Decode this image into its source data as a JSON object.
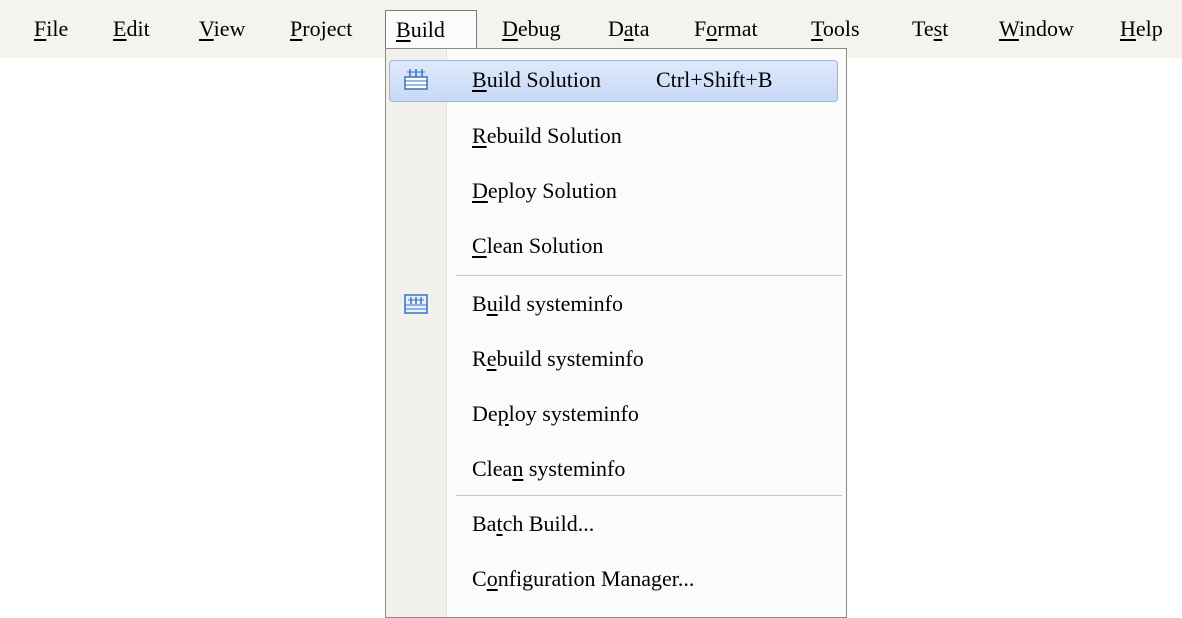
{
  "menubar": {
    "items": [
      {
        "pre": "",
        "u": "F",
        "post": "ile"
      },
      {
        "pre": "",
        "u": "E",
        "post": "dit"
      },
      {
        "pre": "",
        "u": "V",
        "post": "iew"
      },
      {
        "pre": "",
        "u": "P",
        "post": "roject"
      },
      {
        "pre": "",
        "u": "B",
        "post": "uild"
      },
      {
        "pre": "",
        "u": "D",
        "post": "ebug"
      },
      {
        "pre": "D",
        "u": "a",
        "post": "ta"
      },
      {
        "pre": "F",
        "u": "o",
        "post": "rmat"
      },
      {
        "pre": "",
        "u": "T",
        "post": "ools"
      },
      {
        "pre": "Te",
        "u": "s",
        "post": "t"
      },
      {
        "pre": "",
        "u": "W",
        "post": "indow"
      },
      {
        "pre": "",
        "u": "H",
        "post": "elp"
      }
    ]
  },
  "build_menu": {
    "items": [
      {
        "pre": "",
        "u": "B",
        "post": "uild Solution",
        "shortcut": "Ctrl+Shift+B",
        "icon": "build-solution-icon"
      },
      {
        "pre": "",
        "u": "R",
        "post": "ebuild Solution",
        "shortcut": "",
        "icon": ""
      },
      {
        "pre": "",
        "u": "D",
        "post": "eploy Solution",
        "shortcut": "",
        "icon": ""
      },
      {
        "pre": "",
        "u": "C",
        "post": "lean Solution",
        "shortcut": "",
        "icon": ""
      },
      {
        "pre": "B",
        "u": "u",
        "post": "ild systeminfo",
        "shortcut": "",
        "icon": "build-project-icon"
      },
      {
        "pre": "R",
        "u": "e",
        "post": "build systeminfo",
        "shortcut": "",
        "icon": ""
      },
      {
        "pre": "De",
        "u": "p",
        "post": "loy systeminfo",
        "shortcut": "",
        "icon": ""
      },
      {
        "pre": "Clea",
        "u": "n",
        "post": " systeminfo",
        "shortcut": "",
        "icon": ""
      },
      {
        "pre": "Ba",
        "u": "t",
        "post": "ch Build...",
        "shortcut": "",
        "icon": ""
      },
      {
        "pre": "C",
        "u": "o",
        "post": "nfiguration Manager...",
        "shortcut": "",
        "icon": ""
      }
    ]
  },
  "colors": {
    "menubar_bg": "#f4f3ee",
    "highlight_border": "#9db6e0",
    "highlight_fill": "#c7d8f6",
    "icon_blue": "#3a6fc8"
  }
}
